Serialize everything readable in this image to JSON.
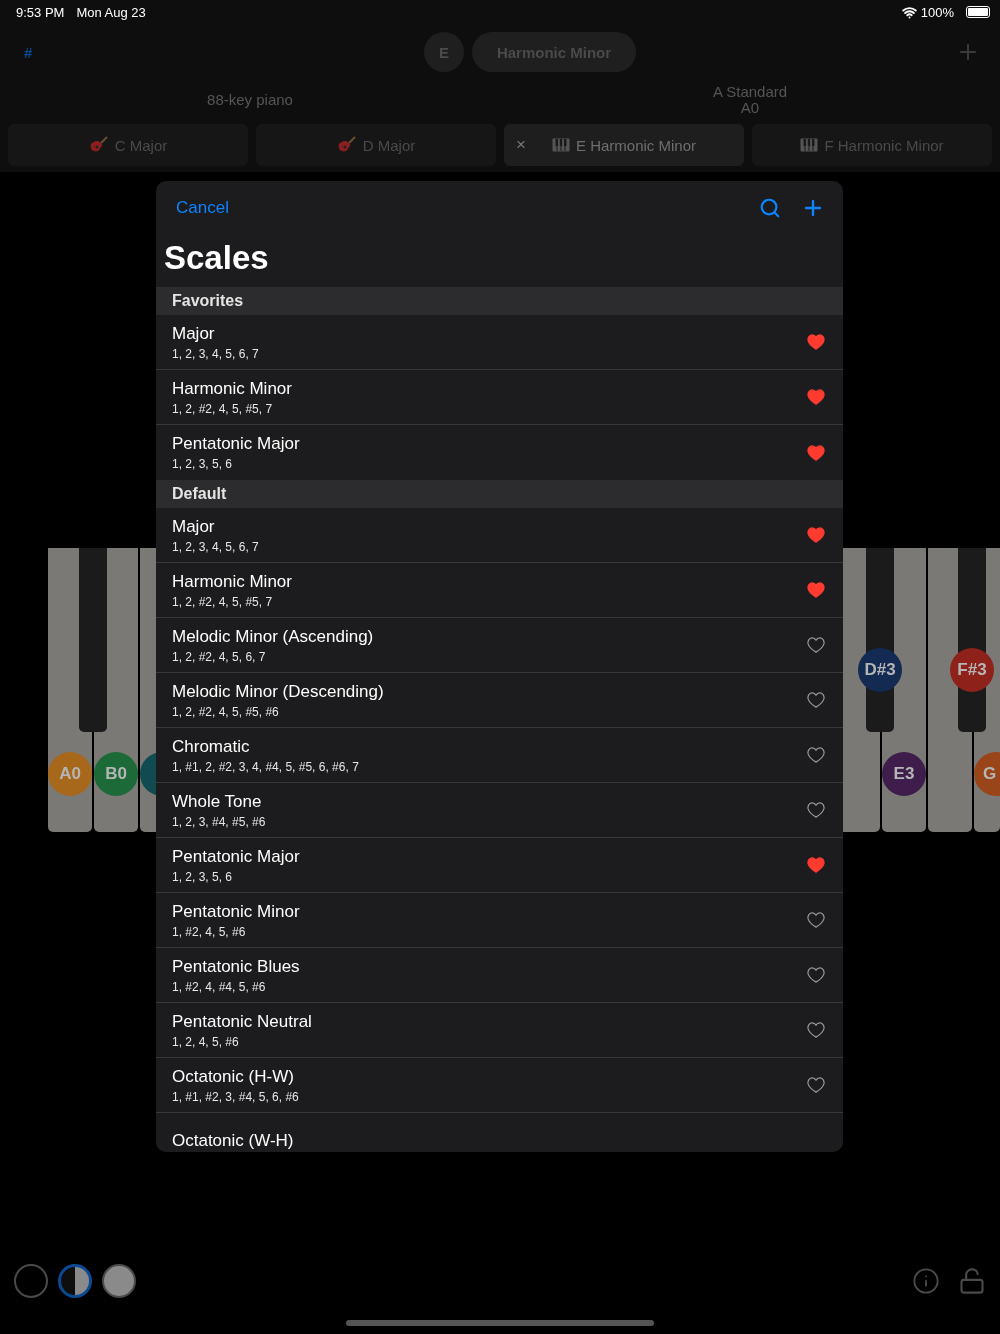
{
  "status_bar": {
    "time": "9:53 PM",
    "date": "Mon Aug 23",
    "battery": "100%"
  },
  "toolbar": {
    "accidental": "#",
    "key": "E",
    "scale": "Harmonic Minor"
  },
  "instrument": {
    "name": "88-key piano",
    "tuning": "A Standard",
    "lowest_note": "A0"
  },
  "tabs": [
    {
      "kind": "guitar",
      "label": "C Major",
      "selected": false
    },
    {
      "kind": "guitar",
      "label": "D Major",
      "selected": false
    },
    {
      "kind": "piano",
      "label": "E Harmonic Minor",
      "selected": true,
      "close": "×"
    },
    {
      "kind": "piano",
      "label": "F Harmonic Minor",
      "selected": false
    }
  ],
  "piano": {
    "left_white": [
      {
        "kind": "marked",
        "note": "A0",
        "color": "#a8681c"
      },
      {
        "kind": "marked",
        "note": "B0",
        "color": "#1b6a38"
      },
      {
        "kind": "marked",
        "color": "#124a52"
      }
    ],
    "right_white": [
      {
        "kind": "plain"
      },
      {
        "kind": "marked",
        "note": "E3",
        "color": "#3e1d4c"
      },
      {
        "kind": "plain"
      },
      {
        "kind": "marked",
        "note": "G",
        "color": "#9a4519"
      }
    ],
    "right_black": [
      {
        "kind": "marked",
        "note": "D#3",
        "color": "#132a52"
      },
      {
        "kind": "marked",
        "note": "F#3",
        "color": "#8e221b"
      }
    ]
  },
  "sheet": {
    "cancel": "Cancel",
    "title": "Scales",
    "sections": [
      {
        "title": "Favorites",
        "scales": [
          {
            "name": "Major",
            "notes": "1, 2, 3, 4, 5, 6, 7",
            "favorite": true
          },
          {
            "name": "Harmonic Minor",
            "notes": "1, 2, #2, 4, 5, #5, 7",
            "favorite": true
          },
          {
            "name": "Pentatonic Major",
            "notes": "1, 2, 3, 5, 6",
            "favorite": true
          }
        ]
      },
      {
        "title": "Default",
        "scales": [
          {
            "name": "Major",
            "notes": "1, 2, 3, 4, 5, 6, 7",
            "favorite": true
          },
          {
            "name": "Harmonic Minor",
            "notes": "1, 2, #2, 4, 5, #5, 7",
            "favorite": true
          },
          {
            "name": "Melodic Minor (Ascending)",
            "notes": "1, 2, #2, 4, 5, 6, 7",
            "favorite": false
          },
          {
            "name": "Melodic Minor (Descending)",
            "notes": "1, 2, #2, 4, 5, #5, #6",
            "favorite": false
          },
          {
            "name": "Chromatic",
            "notes": "1, #1, 2, #2, 3, 4, #4, 5, #5, 6, #6, 7",
            "favorite": false
          },
          {
            "name": "Whole Tone",
            "notes": "1, 2, 3, #4, #5, #6",
            "favorite": false
          },
          {
            "name": "Pentatonic Major",
            "notes": "1, 2, 3, 5, 6",
            "favorite": true
          },
          {
            "name": "Pentatonic Minor",
            "notes": "1, #2, 4, 5, #6",
            "favorite": false
          },
          {
            "name": "Pentatonic Blues",
            "notes": "1, #2, 4, #4, 5, #6",
            "favorite": false
          },
          {
            "name": "Pentatonic Neutral",
            "notes": "1, 2, 4, 5, #6",
            "favorite": false
          },
          {
            "name": "Octatonic (H-W)",
            "notes": "1, #1, #2, 3, #4, 5, 6, #6",
            "favorite": false
          },
          {
            "name": "Octatonic (W-H)"
          }
        ]
      }
    ]
  },
  "display_modes": [
    {
      "kind": "empty",
      "selected": false
    },
    {
      "kind": "half",
      "selected": true
    },
    {
      "kind": "filled",
      "selected": false
    }
  ]
}
